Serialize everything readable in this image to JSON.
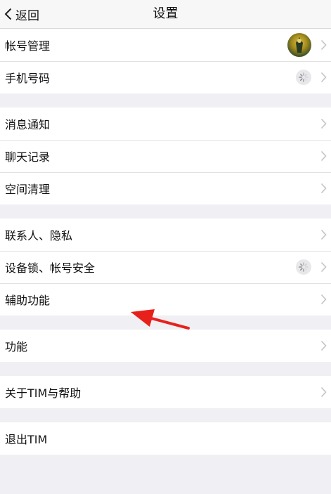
{
  "header": {
    "back_label": "返回",
    "title": "设置"
  },
  "groups": [
    {
      "items": [
        {
          "label": "帐号管理"
        },
        {
          "label": "手机号码"
        }
      ]
    },
    {
      "items": [
        {
          "label": "消息通知"
        },
        {
          "label": "聊天记录"
        },
        {
          "label": "空间清理"
        }
      ]
    },
    {
      "items": [
        {
          "label": "联系人、隐私"
        },
        {
          "label": "设备锁、帐号安全"
        },
        {
          "label": "辅助功能"
        }
      ]
    },
    {
      "items": [
        {
          "label": "功能"
        }
      ]
    },
    {
      "items": [
        {
          "label": "关于TIM与帮助"
        }
      ]
    },
    {
      "items": [
        {
          "label": "退出TIM"
        }
      ]
    }
  ],
  "icons": {
    "back": "chevron-left-icon",
    "row_chevron": "chevron-right-icon",
    "loading": "loading-spinner-icon",
    "avatar": "avatar"
  },
  "colors": {
    "background": "#efeff4",
    "annotation_arrow": "#e8201c"
  }
}
